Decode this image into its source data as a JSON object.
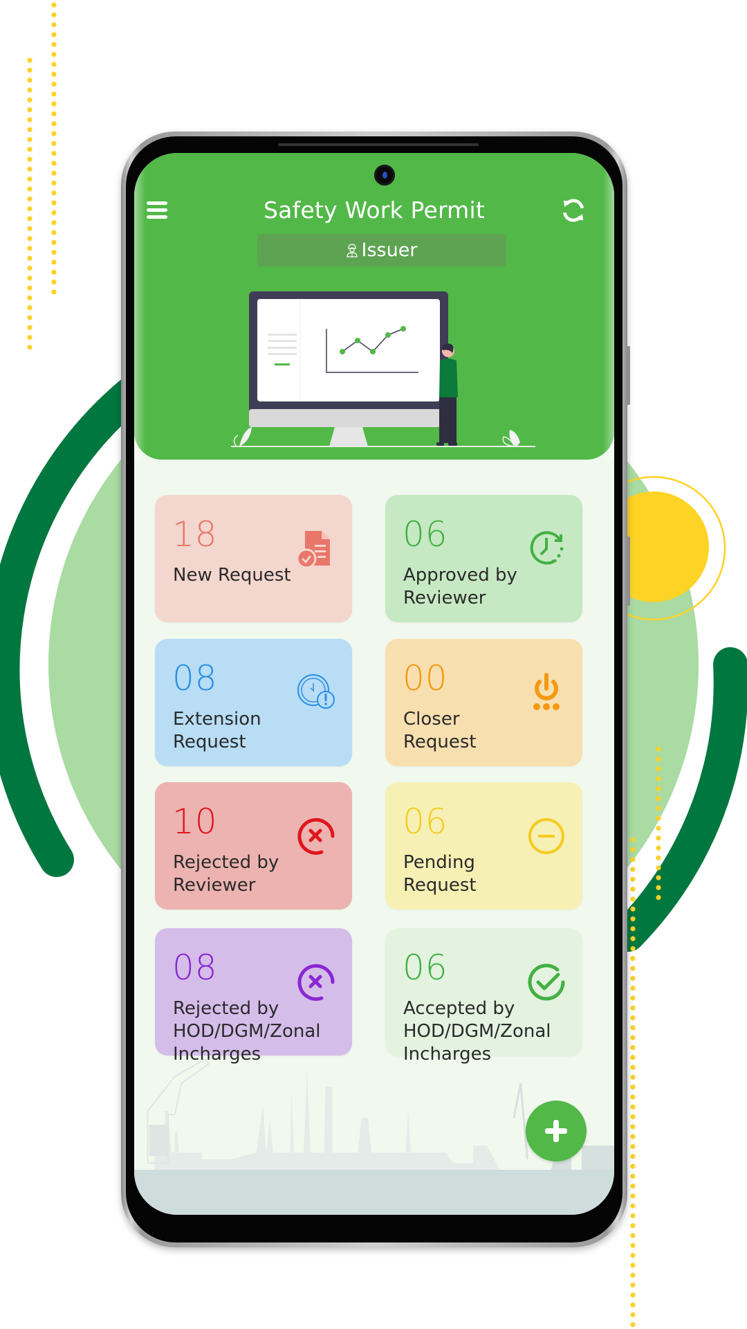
{
  "app": {
    "title": "Safety Work Permit",
    "role": "Issuer",
    "menu_icon": "hamburger-menu-icon",
    "refresh_icon": "refresh-icon",
    "role_icon": "worker-icon"
  },
  "colors": {
    "brand_green": "#52b848",
    "dark_green": "#00773f",
    "light_green": "#a9dba3",
    "accent_yellow": "#fcd12a"
  },
  "cards": [
    {
      "count": "18",
      "label_lines": [
        "New Request"
      ],
      "icon": "document-check-icon",
      "bg": "#f3d6cd",
      "accent": "#e8776a"
    },
    {
      "count": "06",
      "label_lines": [
        "Approved by",
        "Reviewer"
      ],
      "icon": "clock-rotate-icon",
      "bg": "#c6e9c3",
      "accent": "#43b043"
    },
    {
      "count": "08",
      "label_lines": [
        "Extension",
        "Request"
      ],
      "icon": "clock-alert-icon",
      "bg": "#b8ddf5",
      "accent": "#2b8fe6"
    },
    {
      "count": "00",
      "label_lines": [
        "Closer",
        "Request"
      ],
      "icon": "power-icon",
      "bg": "#f8dfb0",
      "accent": "#f39a12"
    },
    {
      "count": "10",
      "label_lines": [
        "Rejected by",
        "Reviewer"
      ],
      "icon": "circle-x-icon",
      "bg": "#ecb3b1",
      "accent": "#e0161d"
    },
    {
      "count": "06",
      "label_lines": [
        "Pending",
        "Request"
      ],
      "icon": "circle-minus-icon",
      "bg": "#f7f0b5",
      "accent": "#f4cb22"
    },
    {
      "count": "08",
      "label_lines": [
        "Rejected by",
        "HOD/DGM/Zonal",
        "Incharges"
      ],
      "icon": "circle-x-icon",
      "bg": "#d5bdea",
      "accent": "#8a27d1"
    },
    {
      "count": "06",
      "label_lines": [
        "Accepted by",
        "HOD/DGM/Zonal",
        "Incharges"
      ],
      "icon": "circle-check-icon",
      "bg": "#e3f3e0",
      "accent": "#43b043"
    }
  ],
  "fab": {
    "icon": "plus-icon"
  }
}
